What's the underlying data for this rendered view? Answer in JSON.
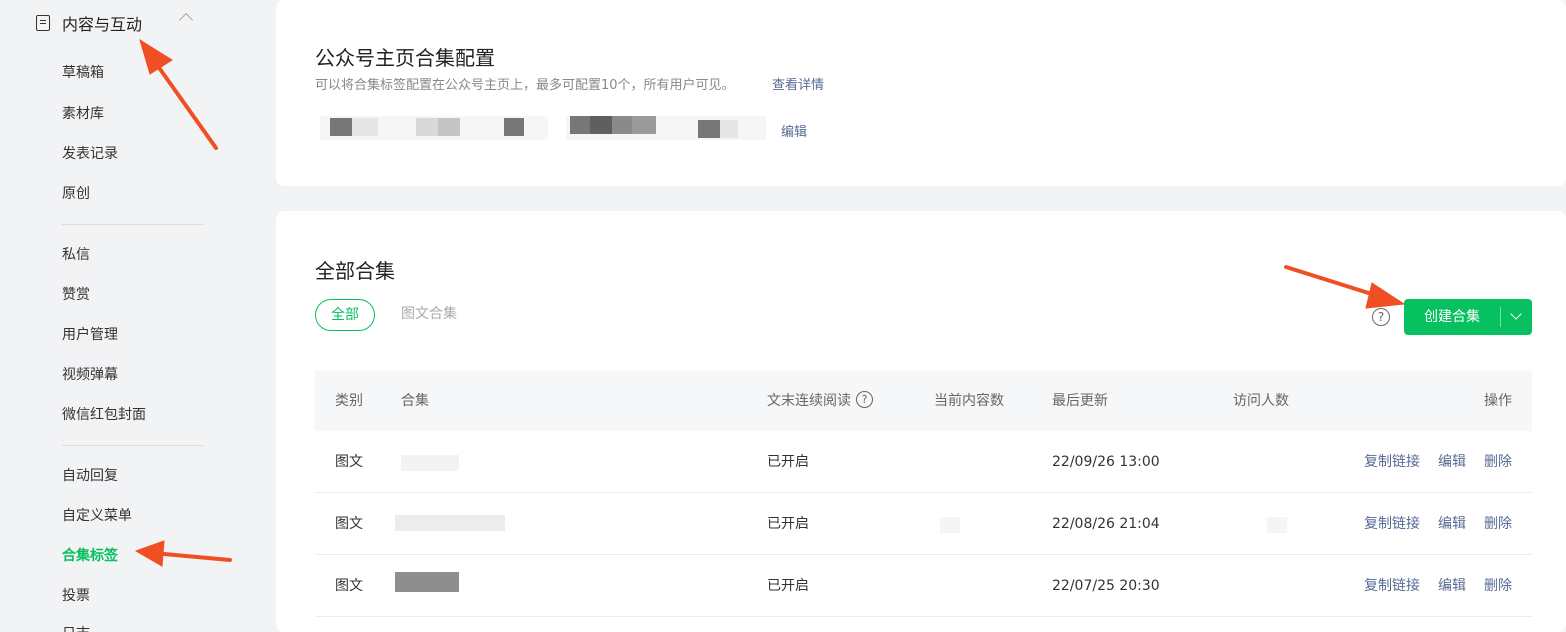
{
  "sidebar": {
    "group_title": "内容与互动",
    "items_a": [
      "草稿箱",
      "素材库",
      "发表记录",
      "原创"
    ],
    "items_b": [
      "私信",
      "赞赏",
      "用户管理",
      "视频弹幕",
      "微信红包封面"
    ],
    "items_c": [
      "自动回复",
      "自定义菜单",
      "合集标签",
      "投票",
      "日志..."
    ],
    "active_item": "合集标签"
  },
  "homepage_config": {
    "title": "公众号主页合集配置",
    "description": "可以将合集标签配置在公众号主页上，最多可配置10个，所有用户可见。",
    "details_link": "查看详情",
    "edit_link": "编辑"
  },
  "collections": {
    "title": "全部合集",
    "tabs": [
      "全部",
      "图文合集"
    ],
    "create_button": "创建合集",
    "help_symbol": "?",
    "columns": [
      "类别",
      "合集",
      "文末连续阅读",
      "当前内容数",
      "最后更新",
      "访问人数",
      "操作"
    ],
    "rows": [
      {
        "category": "图文",
        "continuous_read": "已开启",
        "updated": "22/09/26 13:00"
      },
      {
        "category": "图文",
        "continuous_read": "已开启",
        "updated": "22/08/26 21:04"
      },
      {
        "category": "图文",
        "continuous_read": "已开启",
        "updated": "22/07/25 20:30"
      }
    ],
    "actions": [
      "复制链接",
      "编辑",
      "删除"
    ]
  },
  "colors": {
    "accent": "#07c160",
    "link": "#576b95",
    "annotation_arrow": "#f04e23"
  }
}
